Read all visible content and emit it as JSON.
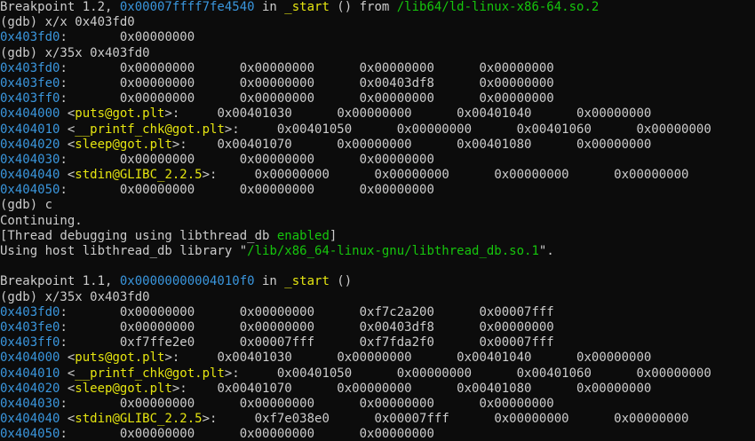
{
  "colors": {
    "background": "#0c0c0c",
    "text": "#cccccc",
    "address": "#3a96dd",
    "symbol": "#e5e510",
    "path": "#16c60c"
  },
  "lines": [
    [
      {
        "t": "Breakpoint 1.2, ",
        "c": "plain"
      },
      {
        "t": "0x00007ffff7fe4540",
        "c": "addr"
      },
      {
        "t": " in ",
        "c": "plain"
      },
      {
        "t": "_start",
        "c": "func"
      },
      {
        "t": " () from ",
        "c": "plain"
      },
      {
        "t": "/lib64/ld-linux-x86-64.so.2",
        "c": "path"
      }
    ],
    [
      {
        "t": "(gdb) x/x 0x403fd0",
        "c": "plain"
      }
    ],
    [
      {
        "t": "0x403fd0",
        "c": "addr"
      },
      {
        "t": ":       0x00000000",
        "c": "plain"
      }
    ],
    [
      {
        "t": "(gdb) x/35x 0x403fd0",
        "c": "plain"
      }
    ],
    [
      {
        "t": "0x403fd0",
        "c": "addr"
      },
      {
        "t": ":       0x00000000      0x00000000      0x00000000      0x00000000",
        "c": "plain"
      }
    ],
    [
      {
        "t": "0x403fe0",
        "c": "addr"
      },
      {
        "t": ":       0x00000000      0x00000000      0x00403df8      0x00000000",
        "c": "plain"
      }
    ],
    [
      {
        "t": "0x403ff0",
        "c": "addr"
      },
      {
        "t": ":       0x00000000      0x00000000      0x00000000      0x00000000",
        "c": "plain"
      }
    ],
    [
      {
        "t": "0x404000",
        "c": "addr"
      },
      {
        "t": " <",
        "c": "plain"
      },
      {
        "t": "puts@got.plt",
        "c": "sym"
      },
      {
        "t": ">:     0x00401030      0x00000000      0x00401040      0x00000000",
        "c": "plain"
      }
    ],
    [
      {
        "t": "0x404010",
        "c": "addr"
      },
      {
        "t": " <",
        "c": "plain"
      },
      {
        "t": "__printf_chk@got.plt",
        "c": "sym"
      },
      {
        "t": ">:     0x00401050      0x00000000      0x00401060      0x00000000",
        "c": "plain"
      }
    ],
    [
      {
        "t": "0x404020",
        "c": "addr"
      },
      {
        "t": " <",
        "c": "plain"
      },
      {
        "t": "sleep@got.plt",
        "c": "sym"
      },
      {
        "t": ">:    0x00401070      0x00000000      0x00401080      0x00000000",
        "c": "plain"
      }
    ],
    [
      {
        "t": "0x404030",
        "c": "addr"
      },
      {
        "t": ":       0x00000000      0x00000000      0x00000000",
        "c": "plain"
      }
    ],
    [
      {
        "t": "0x404040",
        "c": "addr"
      },
      {
        "t": " <",
        "c": "plain"
      },
      {
        "t": "stdin@GLIBC_2.2.5",
        "c": "sym"
      },
      {
        "t": ">:     0x00000000      0x00000000      0x00000000      0x00000000",
        "c": "plain"
      }
    ],
    [
      {
        "t": "0x404050",
        "c": "addr"
      },
      {
        "t": ":       0x00000000      0x00000000      0x00000000",
        "c": "plain"
      }
    ],
    [
      {
        "t": "(gdb) c",
        "c": "plain"
      }
    ],
    [
      {
        "t": "Continuing.",
        "c": "plain"
      }
    ],
    [
      {
        "t": "[Thread debugging using libthread_db ",
        "c": "plain"
      },
      {
        "t": "enabled",
        "c": "kw"
      },
      {
        "t": "]",
        "c": "plain"
      }
    ],
    [
      {
        "t": "Using host libthread_db library \"",
        "c": "plain"
      },
      {
        "t": "/lib/x86_64-linux-gnu/libthread_db.so.1",
        "c": "path"
      },
      {
        "t": "\".",
        "c": "plain"
      }
    ],
    [
      {
        "t": "",
        "c": "plain"
      }
    ],
    [
      {
        "t": "Breakpoint 1.1, ",
        "c": "plain"
      },
      {
        "t": "0x00000000004010f0",
        "c": "addr"
      },
      {
        "t": " in ",
        "c": "plain"
      },
      {
        "t": "_start",
        "c": "func"
      },
      {
        "t": " ()",
        "c": "plain"
      }
    ],
    [
      {
        "t": "(gdb) x/35x 0x403fd0",
        "c": "plain"
      }
    ],
    [
      {
        "t": "0x403fd0",
        "c": "addr"
      },
      {
        "t": ":       0x00000000      0x00000000      0xf7c2a200      0x00007fff",
        "c": "plain"
      }
    ],
    [
      {
        "t": "0x403fe0",
        "c": "addr"
      },
      {
        "t": ":       0x00000000      0x00000000      0x00403df8      0x00000000",
        "c": "plain"
      }
    ],
    [
      {
        "t": "0x403ff0",
        "c": "addr"
      },
      {
        "t": ":       0xf7ffe2e0      0x00007fff      0xf7fda2f0      0x00007fff",
        "c": "plain"
      }
    ],
    [
      {
        "t": "0x404000",
        "c": "addr"
      },
      {
        "t": " <",
        "c": "plain"
      },
      {
        "t": "puts@got.plt",
        "c": "sym"
      },
      {
        "t": ">:     0x00401030      0x00000000      0x00401040      0x00000000",
        "c": "plain"
      }
    ],
    [
      {
        "t": "0x404010",
        "c": "addr"
      },
      {
        "t": " <",
        "c": "plain"
      },
      {
        "t": "__printf_chk@got.plt",
        "c": "sym"
      },
      {
        "t": ">:     0x00401050      0x00000000      0x00401060      0x00000000",
        "c": "plain"
      }
    ],
    [
      {
        "t": "0x404020",
        "c": "addr"
      },
      {
        "t": " <",
        "c": "plain"
      },
      {
        "t": "sleep@got.plt",
        "c": "sym"
      },
      {
        "t": ">:    0x00401070      0x00000000      0x00401080      0x00000000",
        "c": "plain"
      }
    ],
    [
      {
        "t": "0x404030",
        "c": "addr"
      },
      {
        "t": ":       0x00000000      0x00000000      0x00000000      0x00000000",
        "c": "plain"
      }
    ],
    [
      {
        "t": "0x404040",
        "c": "addr"
      },
      {
        "t": " <",
        "c": "plain"
      },
      {
        "t": "stdin@GLIBC_2.2.5",
        "c": "sym"
      },
      {
        "t": ">:     0xf7e038e0      0x00007fff      0x00000000      0x00000000",
        "c": "plain"
      }
    ],
    [
      {
        "t": "0x404050",
        "c": "addr"
      },
      {
        "t": ":       0x00000000      0x00000000      0x00000000",
        "c": "plain"
      }
    ]
  ]
}
